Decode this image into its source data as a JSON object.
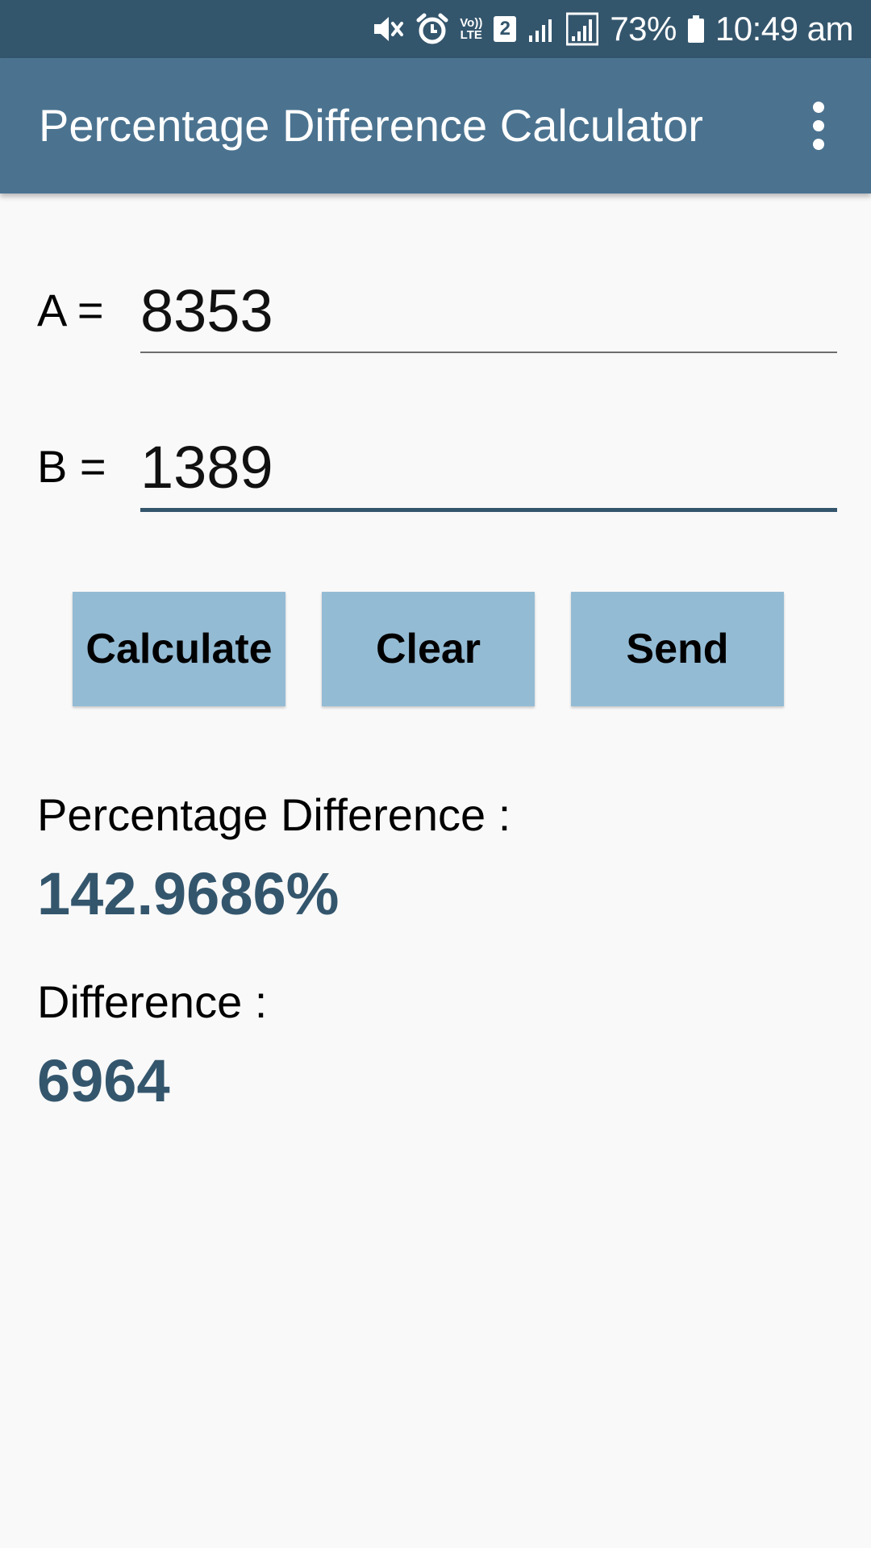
{
  "status_bar": {
    "battery_percent": "73%",
    "time": "10:49 am",
    "sim_badge": "2",
    "volte_top": "Vo))",
    "volte_bottom": "LTE",
    "icons": [
      "mute-icon",
      "alarm-icon",
      "volte-icon",
      "sim-2-icon",
      "signal-icon",
      "signal-icon",
      "battery-icon"
    ]
  },
  "app_bar": {
    "title": "Percentage Difference Calculator",
    "menu_icon": "more-vert-icon"
  },
  "inputs": {
    "a_label": "A =",
    "a_value": "8353",
    "b_label": "B =",
    "b_value": "1389"
  },
  "buttons": {
    "calculate": "Calculate",
    "clear": "Clear",
    "send": "Send"
  },
  "results": {
    "percentage_label": "Percentage Difference :",
    "percentage_value": "142.9686%",
    "difference_label": "Difference :",
    "difference_value": "6964"
  },
  "colors": {
    "status_bar": "#34566d",
    "app_bar": "#4b7390",
    "button": "#94bbd4",
    "result_value": "#34566d",
    "background": "#f9f9f9"
  }
}
